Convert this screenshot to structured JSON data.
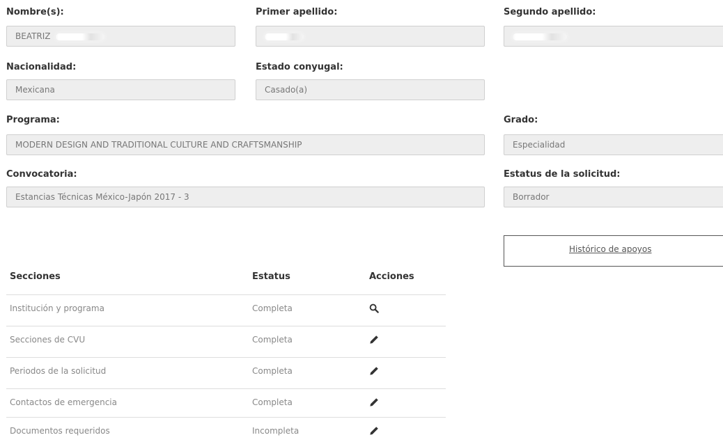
{
  "form": {
    "nombres": {
      "label": "Nombre(s):",
      "value": "BEATRIZ"
    },
    "primer_apellido": {
      "label": "Primer apellido:",
      "value": ""
    },
    "segundo_apellido": {
      "label": "Segundo apellido:",
      "value": ""
    },
    "nacionalidad": {
      "label": "Nacionalidad:",
      "value": "Mexicana"
    },
    "estado_conyugal": {
      "label": "Estado conyugal:",
      "value": "Casado(a)"
    },
    "programa": {
      "label": "Programa:",
      "value": "MODERN DESIGN AND TRADITIONAL CULTURE AND CRAFTSMANSHIP"
    },
    "grado": {
      "label": "Grado:",
      "value": "Especialidad"
    },
    "convocatoria": {
      "label": "Convocatoria:",
      "value": "Estancias Técnicas México-Japón 2017 - 3"
    },
    "estatus_solicitud": {
      "label": "Estatus de la solicitud:",
      "value": "Borrador"
    }
  },
  "historico_button_label": "Histórico de apoyos",
  "table": {
    "headers": {
      "secciones": "Secciones",
      "estatus": "Estatus",
      "acciones": "Acciones"
    },
    "rows": [
      {
        "seccion": "Institución y programa",
        "estatus": "Completa",
        "accion_icon": "search-icon"
      },
      {
        "seccion": "Secciones de CVU",
        "estatus": "Completa",
        "accion_icon": "pencil-icon"
      },
      {
        "seccion": "Periodos de la solicitud",
        "estatus": "Completa",
        "accion_icon": "pencil-icon"
      },
      {
        "seccion": "Contactos de emergencia",
        "estatus": "Completa",
        "accion_icon": "pencil-icon"
      },
      {
        "seccion": "Documentos requeridos",
        "estatus": "Incompleta",
        "accion_icon": "pencil-icon"
      }
    ]
  }
}
